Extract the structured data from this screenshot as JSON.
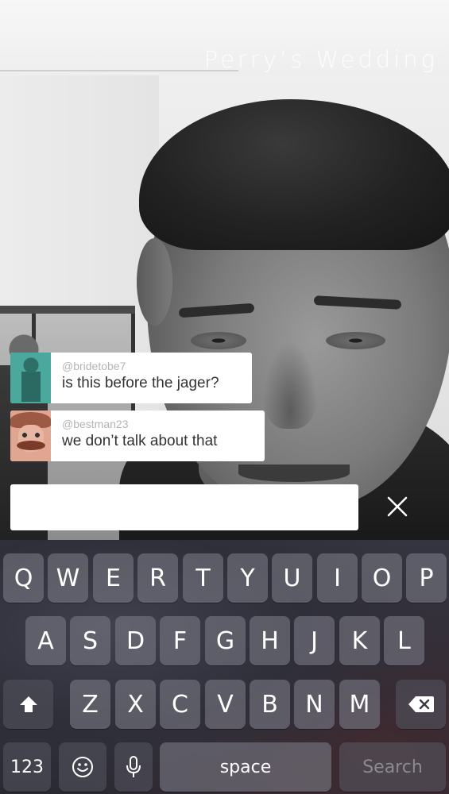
{
  "stream": {
    "title": "Perry’s Wedding"
  },
  "comments": [
    {
      "handle": "@bridetobe7",
      "text": "is this before the jager?",
      "avatar": "avatar-bride"
    },
    {
      "handle": "@bestman23",
      "text": "we don’t talk about that",
      "avatar": "avatar-bestman"
    }
  ],
  "input": {
    "value": "",
    "placeholder": "",
    "close_icon": "close-icon"
  },
  "keyboard": {
    "row1": [
      "Q",
      "W",
      "E",
      "R",
      "T",
      "Y",
      "U",
      "I",
      "O",
      "P"
    ],
    "row2": [
      "A",
      "S",
      "D",
      "F",
      "G",
      "H",
      "J",
      "K",
      "L"
    ],
    "row3": [
      "Z",
      "X",
      "C",
      "V",
      "B",
      "N",
      "M"
    ],
    "numbers_label": "123",
    "space_label": "space",
    "search_label": "Search",
    "shift_icon": "shift-icon",
    "delete_icon": "delete-icon",
    "emoji_icon": "emoji-icon",
    "mic_icon": "microphone-icon"
  },
  "colors": {
    "avatar_bride": "#4aa89d",
    "avatar_bestman": "#e1a692",
    "comment_bg": "#ffffff",
    "handle_text": "#b4b4b4"
  }
}
